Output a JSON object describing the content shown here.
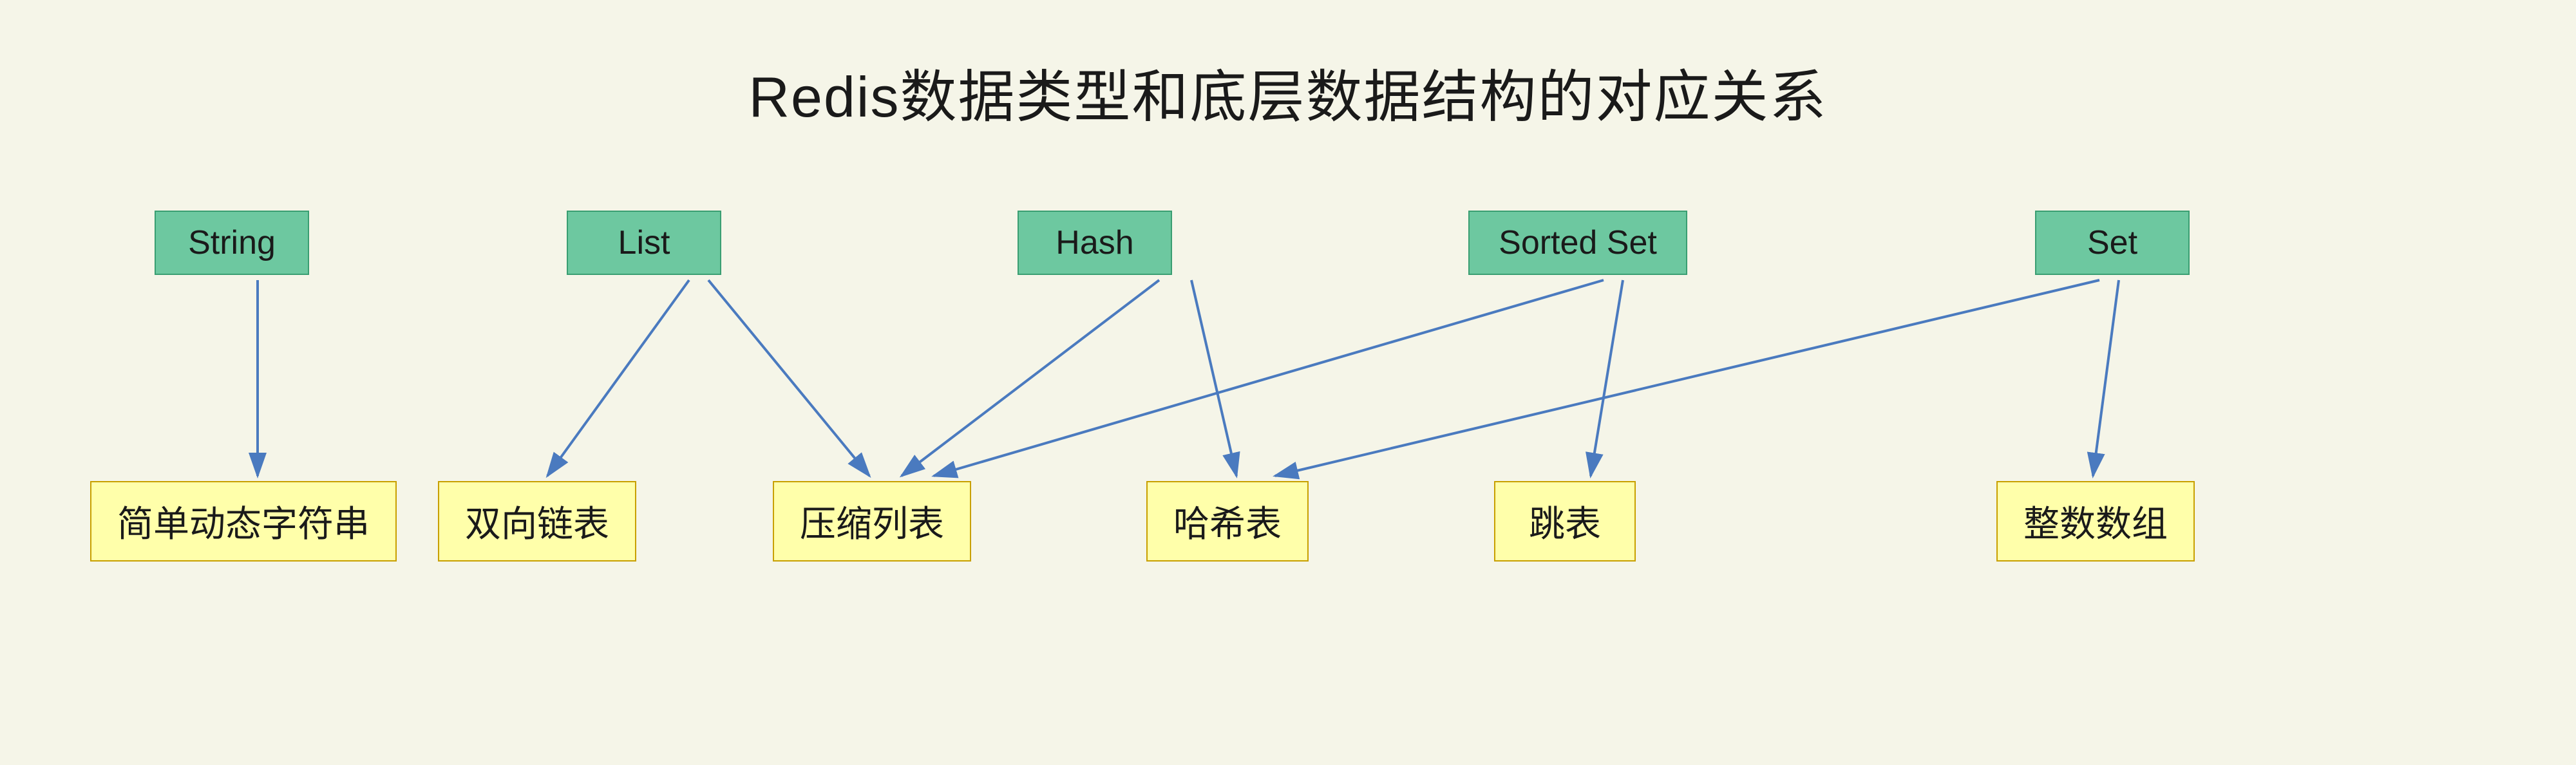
{
  "title": "Redis数据类型和底层数据结构的对应关系",
  "types": {
    "string": {
      "label": "String"
    },
    "list": {
      "label": "List"
    },
    "hash": {
      "label": "Hash"
    },
    "sorted_set": {
      "label": "Sorted Set"
    },
    "set": {
      "label": "Set"
    }
  },
  "structures": {
    "sds": {
      "label": "简单动态字符串"
    },
    "linkedlist": {
      "label": "双向链表"
    },
    "ziplist": {
      "label": "压缩列表"
    },
    "hashtable": {
      "label": "哈希表"
    },
    "skiplist": {
      "label": "跳表"
    },
    "intset": {
      "label": "整数数组"
    }
  },
  "colors": {
    "background": "#f5f5e8",
    "type_box_bg": "#6dc8a0",
    "type_box_border": "#3a9e72",
    "struct_box_bg": "#ffffaa",
    "struct_box_border": "#c8a000",
    "arrow_color": "#4a7abf",
    "title_color": "#1a1a1a"
  }
}
